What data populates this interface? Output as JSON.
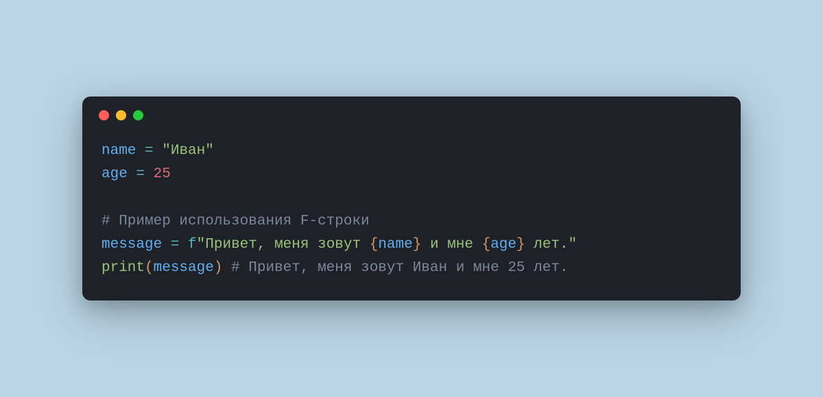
{
  "window_buttons": [
    "close",
    "minimize",
    "zoom"
  ],
  "code": {
    "line1": {
      "var": "name",
      "sp1": " ",
      "op": "=",
      "sp2": " ",
      "str": "\"Иван\""
    },
    "line2": {
      "var": "age",
      "sp1": " ",
      "op": "=",
      "sp2": " ",
      "num": "25"
    },
    "line3": {
      "blank": ""
    },
    "line4": {
      "comment": "# Пример использования F-строки"
    },
    "line5": {
      "var": "message",
      "sp1": " ",
      "op": "=",
      "sp2": " ",
      "fprefix": "f",
      "str_open": "\"",
      "seg1": "Привет, меня зовут ",
      "brace1o": "{",
      "fvar1": "name",
      "brace1c": "}",
      "seg2": " и мне ",
      "brace2o": "{",
      "fvar2": "age",
      "brace2c": "}",
      "seg3": " лет.",
      "str_close": "\""
    },
    "line6": {
      "func": "print",
      "paren_o": "(",
      "arg": "message",
      "paren_c": ")",
      "sp": " ",
      "comment": "# Привет, меня зовут Иван и мне 25 лет."
    }
  }
}
